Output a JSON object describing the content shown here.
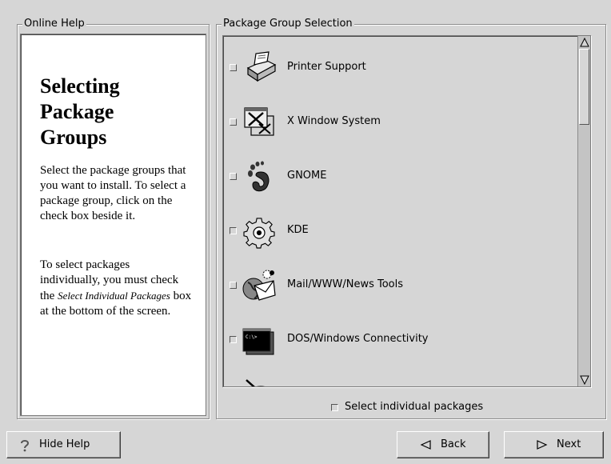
{
  "help": {
    "frame_title": "Online Help",
    "heading_line1": "Selecting",
    "heading_line2": "Package",
    "heading_line3": "Groups",
    "para1": "Select the package groups that you want to install. To select a package group, click on the check box beside it.",
    "para2_start": "To select packages individually, you must check the",
    "para2_em": "Select Individual Packages",
    "para2_end": "box at the bottom of the screen."
  },
  "packages": {
    "frame_title": "Package Group Selection",
    "items": [
      {
        "label": "Printer Support",
        "icon": "printer-icon",
        "checked": false
      },
      {
        "label": "X Window System",
        "icon": "x-window-icon",
        "checked": false
      },
      {
        "label": "GNOME",
        "icon": "gnome-foot-icon",
        "checked": false
      },
      {
        "label": "KDE",
        "icon": "kde-gear-icon",
        "checked": false
      },
      {
        "label": "Mail/WWW/News Tools",
        "icon": "mail-globe-icon",
        "checked": false
      },
      {
        "label": "DOS/Windows Connectivity",
        "icon": "dos-terminal-icon",
        "checked": false
      },
      {
        "label": "",
        "icon": "graphics-palette-icon",
        "checked": false
      }
    ],
    "dos_prompt": "C:\\>",
    "individual_label": "Select individual packages"
  },
  "buttons": {
    "hide_help": "Hide Help",
    "back": "Back",
    "next": "Next"
  }
}
